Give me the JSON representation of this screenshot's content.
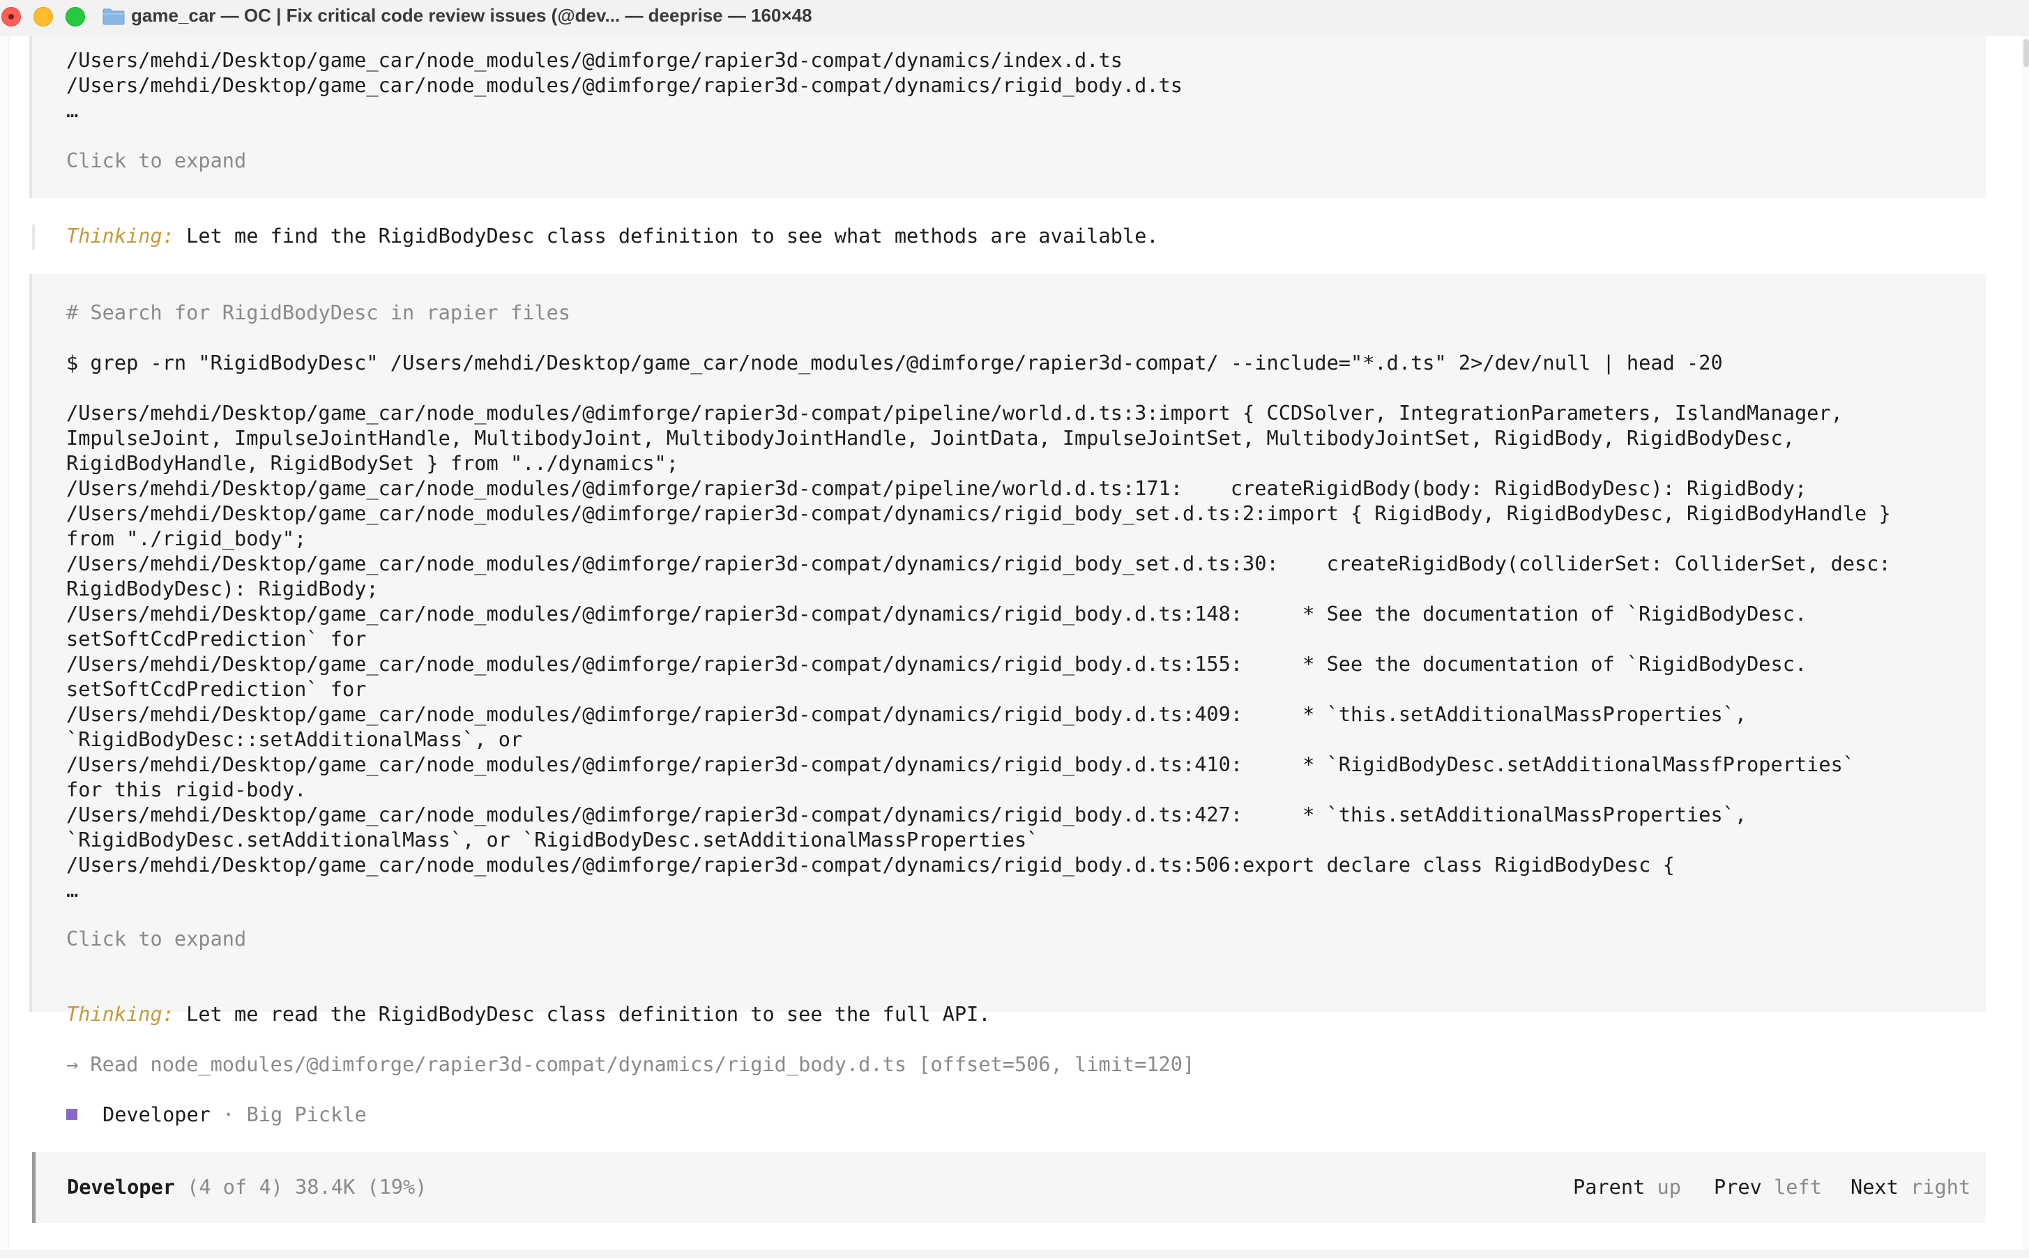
{
  "window": {
    "title": "game_car — OC | Fix critical code review issues (@dev... — deeprise — 160×48",
    "colors": {
      "close": "#ff5f57",
      "minimize": "#febc2e",
      "zoom": "#28c840",
      "folder": "#8ab8e6"
    }
  },
  "terminal": {
    "block1": {
      "lines": [
        "/Users/mehdi/Desktop/game_car/node_modules/@dimforge/rapier3d-compat/dynamics/index.d.ts",
        "/Users/mehdi/Desktop/game_car/node_modules/@dimforge/rapier3d-compat/dynamics/rigid_body.d.ts",
        "…"
      ],
      "expand": "Click to expand"
    },
    "thinking1": {
      "label": "Thinking:",
      "text": " Let me find the RigidBodyDesc class definition to see what methods are available."
    },
    "block2": {
      "comment": "# Search for RigidBodyDesc in rapier files",
      "command": "$ grep -rn \"RigidBodyDesc\" /Users/mehdi/Desktop/game_car/node_modules/@dimforge/rapier3d-compat/ --include=\"*.d.ts\" 2>/dev/null | head -20",
      "output": [
        "/Users/mehdi/Desktop/game_car/node_modules/@dimforge/rapier3d-compat/pipeline/world.d.ts:3:import { CCDSolver, IntegrationParameters, IslandManager,",
        "ImpulseJoint, ImpulseJointHandle, MultibodyJoint, MultibodyJointHandle, JointData, ImpulseJointSet, MultibodyJointSet, RigidBody, RigidBodyDesc,",
        "RigidBodyHandle, RigidBodySet } from \"../dynamics\";",
        "/Users/mehdi/Desktop/game_car/node_modules/@dimforge/rapier3d-compat/pipeline/world.d.ts:171:    createRigidBody(body: RigidBodyDesc): RigidBody;",
        "/Users/mehdi/Desktop/game_car/node_modules/@dimforge/rapier3d-compat/dynamics/rigid_body_set.d.ts:2:import { RigidBody, RigidBodyDesc, RigidBodyHandle }",
        "from \"./rigid_body\";",
        "/Users/mehdi/Desktop/game_car/node_modules/@dimforge/rapier3d-compat/dynamics/rigid_body_set.d.ts:30:    createRigidBody(colliderSet: ColliderSet, desc:",
        "RigidBodyDesc): RigidBody;",
        "/Users/mehdi/Desktop/game_car/node_modules/@dimforge/rapier3d-compat/dynamics/rigid_body.d.ts:148:     * See the documentation of `RigidBodyDesc.",
        "setSoftCcdPrediction` for",
        "/Users/mehdi/Desktop/game_car/node_modules/@dimforge/rapier3d-compat/dynamics/rigid_body.d.ts:155:     * See the documentation of `RigidBodyDesc.",
        "setSoftCcdPrediction` for",
        "/Users/mehdi/Desktop/game_car/node_modules/@dimforge/rapier3d-compat/dynamics/rigid_body.d.ts:409:     * `this.setAdditionalMassProperties`,",
        "`RigidBodyDesc::setAdditionalMass`, or",
        "/Users/mehdi/Desktop/game_car/node_modules/@dimforge/rapier3d-compat/dynamics/rigid_body.d.ts:410:     * `RigidBodyDesc.setAdditionalMassfProperties`",
        "for this rigid-body.",
        "/Users/mehdi/Desktop/game_car/node_modules/@dimforge/rapier3d-compat/dynamics/rigid_body.d.ts:427:     * `this.setAdditionalMassProperties`,",
        "`RigidBodyDesc.setAdditionalMass`, or `RigidBodyDesc.setAdditionalMassProperties`",
        "/Users/mehdi/Desktop/game_car/node_modules/@dimforge/rapier3d-compat/dynamics/rigid_body.d.ts:506:export declare class RigidBodyDesc {",
        "…"
      ],
      "expand": "Click to expand"
    },
    "thinking2": {
      "label": "Thinking:",
      "text": " Let me read the RigidBodyDesc class definition to see the full API."
    },
    "read_line": "→ Read node_modules/@dimforge/rapier3d-compat/dynamics/rigid_body.d.ts [offset=506, limit=120]",
    "agent": {
      "icon": "square-icon",
      "name": "Developer",
      "separator": " · ",
      "model": "Big Pickle",
      "color": "#8b68c8"
    },
    "footer": {
      "agent": "Developer",
      "position": " (4 of 4) 38.4K (19%)",
      "parent": {
        "key": "Parent",
        "hint": "up"
      },
      "prev": {
        "key": "Prev",
        "hint": "left"
      },
      "next": {
        "key": "Next",
        "hint": "right"
      }
    }
  }
}
